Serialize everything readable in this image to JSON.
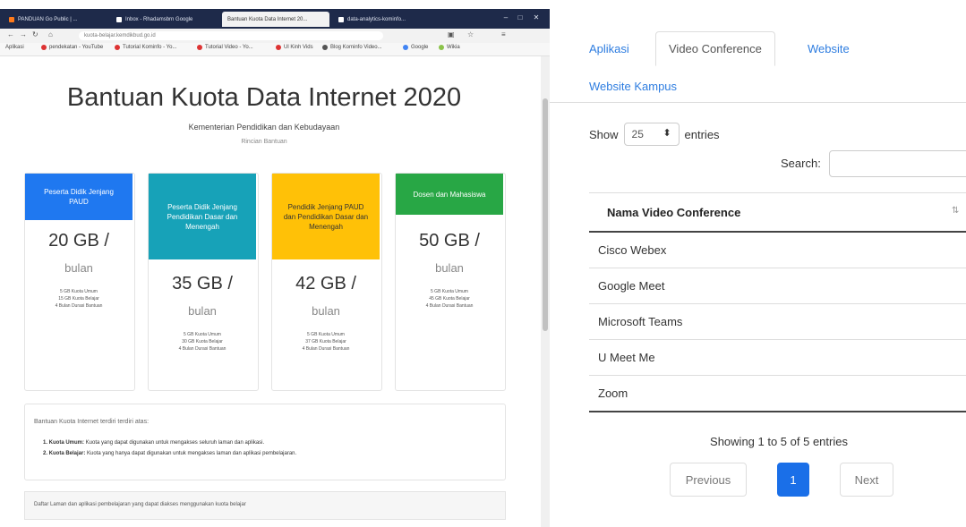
{
  "browser": {
    "tabs": [
      {
        "label": "PANDUAN Go Public | ..."
      },
      {
        "label": "Inbox - Rhadamsbrn Google"
      },
      {
        "label": "Bantuan Kuota Data Internet 20..."
      },
      {
        "label": "data-analytics-kominfo..."
      }
    ],
    "url": "kuota-belajar.kemdikbud.go.id",
    "bookmarks": [
      {
        "label": "Aplikasi"
      },
      {
        "label": "pendekatan - YouTube"
      },
      {
        "label": "Tutorial Kominfo - Yo..."
      },
      {
        "label": "Tutorial Video - Yo..."
      },
      {
        "label": "Ul Kinh Vids"
      },
      {
        "label": "Blog Kominfo Video..."
      },
      {
        "label": "Google"
      },
      {
        "label": "Wikia"
      }
    ]
  },
  "page": {
    "title": "Bantuan Kuota Data Internet 2020",
    "subtitle": "Kementerian Pendidikan dan Kebudayaan",
    "tagline": "Rincian Bantuan",
    "cards": [
      {
        "header": "Peserta Didik Jenjang PAUD",
        "amount": "20 GB /",
        "period": "bulan",
        "details": [
          "5 GB Kuota Umum",
          "15 GB Kuota Belajar",
          "4 Bulan Durasi Bantuan"
        ],
        "color": "#1f78f0"
      },
      {
        "header": "Peserta Didik Jenjang Pendidikan Dasar dan Menengah",
        "amount": "35 GB /",
        "period": "bulan",
        "details": [
          "5 GB Kuota Umum",
          "30 GB Kuota Belajar",
          "4 Bulan Durasi Bantuan"
        ],
        "color": "#17a2b8"
      },
      {
        "header": "Pendidik Jenjang PAUD dan Pendidikan Dasar dan Menengah",
        "amount": "42 GB /",
        "period": "bulan",
        "details": [
          "5 GB Kuota Umum",
          "37 GB Kuota Belajar",
          "4 Bulan Durasi Bantuan"
        ],
        "color": "#ffc107"
      },
      {
        "header": "Dosen dan Mahasiswa",
        "amount": "50 GB /",
        "period": "bulan",
        "details": [
          "5 GB Kuota Umum",
          "45 GB Kuota Belajar",
          "4 Bulan Durasi Bantuan"
        ],
        "color": "#28a745"
      }
    ],
    "info_intro": "Bantuan Kuota Internet terdiri terdiri atas:",
    "info_items": [
      {
        "term": "1. Kuota Umum:",
        "text": " Kuota yang dapat digunakan untuk mengakses seluruh laman dan aplikasi."
      },
      {
        "term": "2. Kuota Belajar:",
        "text": " Kuota yang hanya dapat digunakan untuk mengakses laman dan aplikasi pembelajaran."
      }
    ],
    "footer_text": "Daftar Laman dan aplikasi pembelajaran yang dapat diakses menggunakan kuota belajar"
  },
  "panel": {
    "tabs": [
      "Aplikasi",
      "Video Conference",
      "Website",
      "Website Kampus"
    ],
    "active_tab": "Video Conference",
    "show_label": "Show",
    "show_value": "25",
    "entries_label": "entries",
    "search_label": "Search:",
    "search_value": "",
    "column_header": "Nama Video Conference",
    "sort_glyph": "⇅",
    "rows": [
      "Cisco Webex",
      "Google Meet",
      "Microsoft Teams",
      "U Meet Me",
      "Zoom"
    ],
    "info": "Showing 1 to 5 of 5 entries",
    "pagination": {
      "previous": "Previous",
      "current": "1",
      "next": "Next"
    }
  }
}
